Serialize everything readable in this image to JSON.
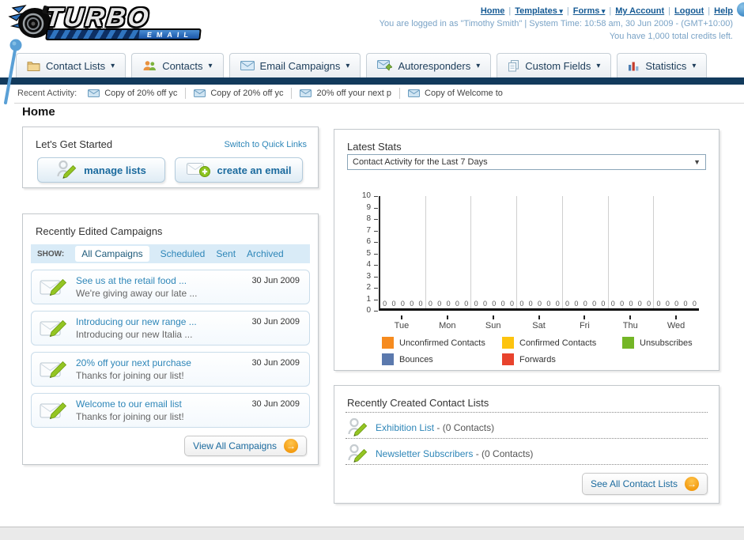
{
  "brand": {
    "title": "TURBO",
    "subtitle": "EMAIL"
  },
  "header": {
    "nav_links": [
      {
        "label": "Home",
        "dropdown": false
      },
      {
        "label": "Templates",
        "dropdown": true
      },
      {
        "label": "Forms",
        "dropdown": true
      },
      {
        "label": "My Account",
        "dropdown": false
      },
      {
        "label": "Logout",
        "dropdown": false
      },
      {
        "label": "Help",
        "dropdown": false
      }
    ],
    "login_info": "You are logged in as \"Timothy Smith\" | System Time: 10:58 am, 30 Jun 2009 - (GMT+10:00)",
    "credits_info": "You have 1,000 total credits left."
  },
  "nav_tabs": [
    {
      "label": "Contact Lists",
      "icon": "folder-icon"
    },
    {
      "label": "Contacts",
      "icon": "contacts-icon"
    },
    {
      "label": "Email Campaigns",
      "icon": "envelope-icon"
    },
    {
      "label": "Autoresponders",
      "icon": "envelope-arrow-icon"
    },
    {
      "label": "Custom Fields",
      "icon": "pages-icon"
    },
    {
      "label": "Statistics",
      "icon": "bar-chart-icon"
    }
  ],
  "recent_activity": {
    "label": "Recent Activity:",
    "items": [
      "Copy of 20% off yc",
      "Copy of 20% off yc",
      "20% off your next p",
      "Copy of Welcome to"
    ]
  },
  "page_title": "Home",
  "get_started": {
    "title": "Let's Get Started",
    "switch_link": "Switch to Quick Links",
    "buttons": [
      {
        "label": "manage lists",
        "icon": "person-pencil-icon"
      },
      {
        "label": "create an email",
        "icon": "envelope-plus-icon"
      }
    ]
  },
  "campaigns": {
    "title": "Recently Edited Campaigns",
    "show_label": "SHOW:",
    "filters": [
      "All Campaigns",
      "Scheduled",
      "Sent",
      "Archived"
    ],
    "active_filter": "All Campaigns",
    "items": [
      {
        "title": "See us at the retail food ...",
        "subtitle": "We're giving away our late ...",
        "date": "30 Jun 2009"
      },
      {
        "title": "Introducing our new range ...",
        "subtitle": "Introducing our new Italia ...",
        "date": "30 Jun 2009"
      },
      {
        "title": "20% off your next purchase",
        "subtitle": "Thanks for joining our list!",
        "date": "30 Jun 2009"
      },
      {
        "title": "Welcome to our email list",
        "subtitle": "Thanks for joining our list!",
        "date": "30 Jun 2009"
      }
    ],
    "view_all_label": "View All Campaigns"
  },
  "stats": {
    "title": "Latest Stats",
    "selected_option": "Contact Activity for the Last 7 Days"
  },
  "chart_data": {
    "type": "bar",
    "title": "Contact Activity for the Last 7 Days",
    "categories": [
      "Tue",
      "Mon",
      "Sun",
      "Sat",
      "Fri",
      "Thu",
      "Wed"
    ],
    "series": [
      {
        "name": "Unconfirmed Contacts",
        "color": "#f68b1f",
        "values": [
          0,
          0,
          0,
          0,
          0,
          0,
          0
        ]
      },
      {
        "name": "Confirmed Contacts",
        "color": "#fdc40f",
        "values": [
          0,
          0,
          0,
          0,
          0,
          0,
          0
        ]
      },
      {
        "name": "Unsubscribes",
        "color": "#74b626",
        "values": [
          0,
          0,
          0,
          0,
          0,
          0,
          0
        ]
      },
      {
        "name": "Bounces",
        "color": "#5b79ad",
        "values": [
          0,
          0,
          0,
          0,
          0,
          0,
          0
        ]
      },
      {
        "name": "Forwards",
        "color": "#e8432d",
        "values": [
          0,
          0,
          0,
          0,
          0,
          0,
          0
        ]
      }
    ],
    "ylim": [
      0,
      10
    ],
    "yticks": [
      0,
      1,
      2,
      3,
      4,
      5,
      6,
      7,
      8,
      9,
      10
    ],
    "grid": "vertical",
    "legend_position": "bottom",
    "value_labels_shown": true
  },
  "contact_lists": {
    "title": "Recently Created Contact Lists",
    "items": [
      {
        "name": "Exhibition List",
        "count_text": "(0 Contacts)"
      },
      {
        "name": "Newsletter Subscribers",
        "count_text": "(0 Contacts)"
      }
    ],
    "see_all_label": "See All Contact Lists"
  },
  "colors": {
    "dark_bar": "#123a5c",
    "link_blue": "#2e86b8",
    "button_text_blue": "#1b6a9e",
    "show_bar_bg": "#d9ebf7",
    "accent_orange": "#f39c12"
  }
}
